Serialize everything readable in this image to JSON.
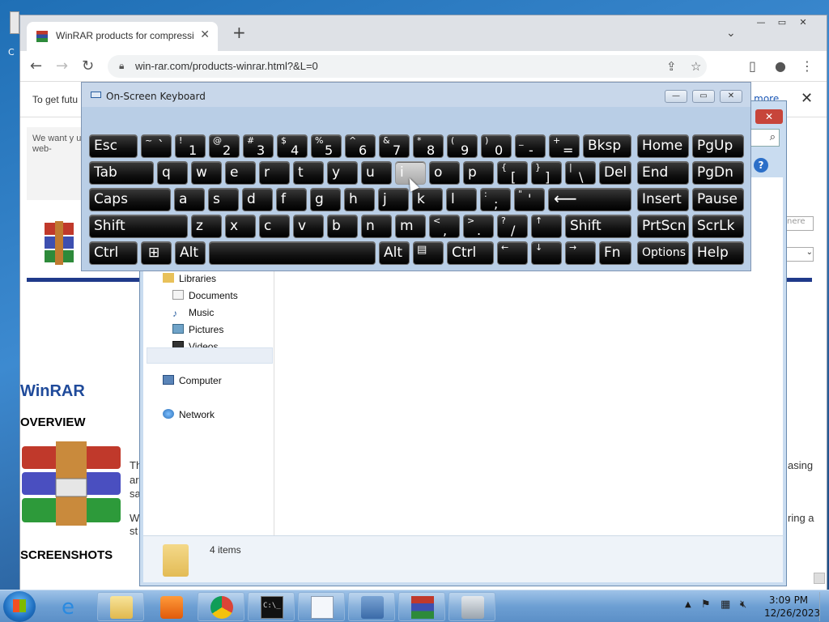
{
  "desktop": {
    "icon_label_fragment": "C"
  },
  "browser": {
    "tab_title": "WinRAR products for compressio",
    "tab_close": "✕",
    "new_tab": "+",
    "url": "win-rar.com/products-winrar.html?&L=0",
    "window_controls": [
      "—",
      "▭",
      "✕"
    ],
    "infobar_text": "To get futu",
    "infobar_link": "rn more",
    "infobar_close": "✕"
  },
  "page": {
    "cookie_text": "We want y use of coo your web-",
    "winrar_heading": "WinRAR",
    "overview_heading": "OVERVIEW",
    "screenshots_heading": "SCREENSHOTS",
    "frag_th": "Th",
    "frag_ar": "ar",
    "frag_sa": "sa",
    "frag_w": "W",
    "frag_st": "st",
    "frag_asing": "asing",
    "frag_ring": "ring a",
    "right_input_placeholder": "nere"
  },
  "explorer": {
    "close": "✕",
    "nav": [
      "Libraries",
      "Documents",
      "Music",
      "Pictures",
      "Videos",
      "Computer",
      "Network"
    ],
    "status": "4 items"
  },
  "osk": {
    "title": "On-Screen Keyboard",
    "buttons": [
      "—",
      "▭",
      "✕"
    ],
    "keys": {
      "esc": "Esc",
      "tab": "Tab",
      "caps": "Caps",
      "shift": "Shift",
      "ctrl": "Ctrl",
      "alt": "Alt",
      "bksp": "Bksp",
      "del": "Del",
      "home": "Home",
      "pgup": "PgUp",
      "end": "End",
      "pgdn": "PgDn",
      "insert": "Insert",
      "pause": "Pause",
      "prtscn": "PrtScn",
      "scrlk": "ScrLk",
      "options": "Options",
      "help": "Help",
      "fn": "Fn",
      "row1": [
        [
          "~",
          "`"
        ],
        [
          "!",
          "1"
        ],
        [
          "@",
          "2"
        ],
        [
          "#",
          "3"
        ],
        [
          "$",
          "4"
        ],
        [
          "%",
          "5"
        ],
        [
          "^",
          "6"
        ],
        [
          "&",
          "7"
        ],
        [
          "*",
          "8"
        ],
        [
          "(",
          "9"
        ],
        [
          ")",
          "0"
        ],
        [
          "_",
          "-"
        ],
        [
          "+",
          "="
        ]
      ],
      "row2": [
        "q",
        "w",
        "e",
        "r",
        "t",
        "y",
        "u",
        "i",
        "o",
        "p"
      ],
      "row2_extra": [
        [
          "{",
          "["
        ],
        [
          "}",
          "]"
        ],
        [
          "|",
          "\\"
        ]
      ],
      "row3": [
        "a",
        "s",
        "d",
        "f",
        "g",
        "h",
        "j",
        "k",
        "l"
      ],
      "row3_extra": [
        [
          ":",
          ";"
        ],
        [
          "\"",
          "'"
        ]
      ],
      "row4": [
        "z",
        "x",
        "c",
        "v",
        "b",
        "n",
        "m"
      ],
      "row4_extra": [
        [
          "<",
          ","
        ],
        [
          ">",
          "."
        ],
        [
          "?",
          "/"
        ]
      ],
      "arrows": [
        "←",
        "↓",
        "→",
        "↑"
      ],
      "enter_glyph": "⟵",
      "menu_glyph": "▤",
      "win_glyph": "⊞"
    },
    "highlighted_key": "i"
  },
  "taskbar": {
    "time": "3:09 PM",
    "date": "12/26/2023",
    "cmd_text": "C:\\_"
  },
  "colors": {
    "osk_bg": "#b9cee6",
    "key_bg": "#111111",
    "taskbar": "#6d9fd3",
    "winrar_blue": "#1f4a9a"
  }
}
